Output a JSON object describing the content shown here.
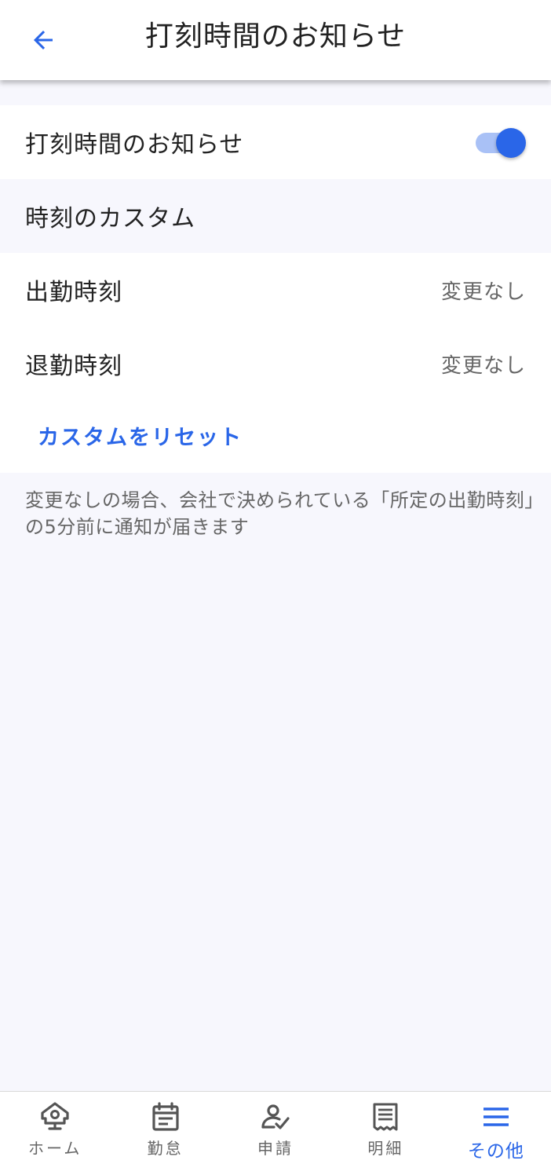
{
  "header": {
    "title": "打刻時間のお知らせ"
  },
  "notification_toggle": {
    "label": "打刻時間のお知らせ",
    "enabled": true
  },
  "custom_section": {
    "title": "時刻のカスタム",
    "items": [
      {
        "label": "出勤時刻",
        "value": "変更なし"
      },
      {
        "label": "退勤時刻",
        "value": "変更なし"
      }
    ],
    "reset_label": "カスタムをリセット"
  },
  "note": "変更なしの場合、会社で決められている「所定の出勤時刻」の5分前に通知が届きます",
  "bottom_nav": {
    "items": [
      {
        "label": "ホーム",
        "icon": "home-icon"
      },
      {
        "label": "勤怠",
        "icon": "calendar-icon"
      },
      {
        "label": "申請",
        "icon": "request-icon"
      },
      {
        "label": "明細",
        "icon": "receipt-icon"
      },
      {
        "label": "その他",
        "icon": "menu-icon",
        "active": true
      }
    ]
  },
  "colors": {
    "accent": "#2a66e8",
    "background": "#f7f7fd",
    "inactive_icon": "#555555"
  }
}
